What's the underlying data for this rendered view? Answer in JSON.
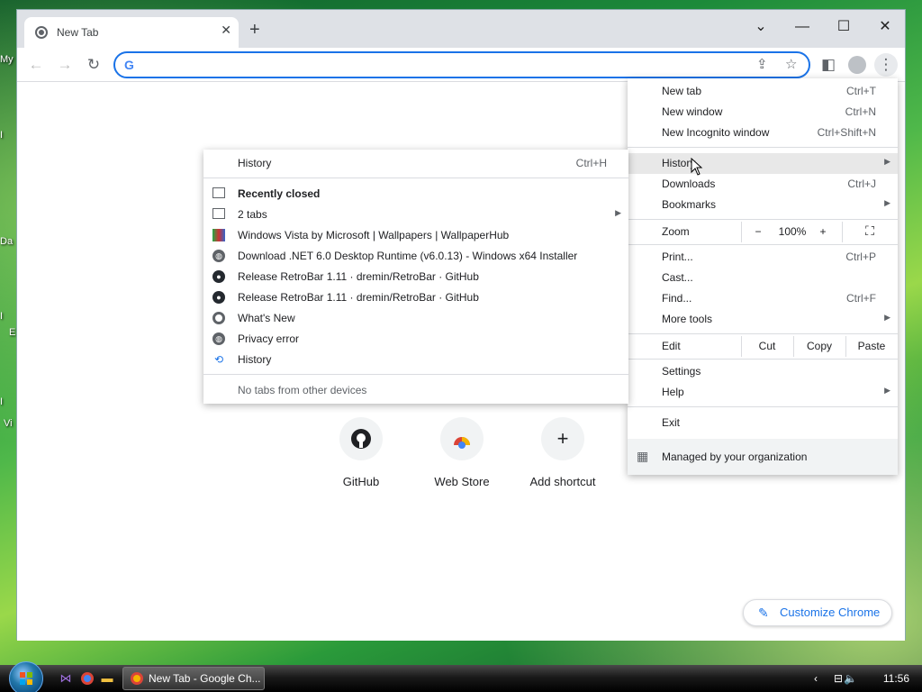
{
  "desktop": {
    "labels": [
      "My",
      "I",
      "Da",
      "I",
      "E",
      "I",
      "Vi"
    ]
  },
  "browser": {
    "tab_title": "New Tab",
    "tab_close": "✕",
    "new_tab_symbol": "+",
    "window_controls": {
      "dropdown": "⌄",
      "minimize": "—",
      "maximize": "☐",
      "close": "✕"
    },
    "toolbar": {
      "back": "←",
      "forward": "→",
      "reload": "↻",
      "omnibox_logo": "G",
      "omnibox_value": ""
    }
  },
  "chrome_menu": {
    "items_top": [
      {
        "label": "New tab",
        "shortcut": "Ctrl+T"
      },
      {
        "label": "New window",
        "shortcut": "Ctrl+N"
      },
      {
        "label": "New Incognito window",
        "shortcut": "Ctrl+Shift+N"
      }
    ],
    "history": {
      "label": "History",
      "highlighted": true
    },
    "downloads": {
      "label": "Downloads",
      "shortcut": "Ctrl+J"
    },
    "bookmarks": {
      "label": "Bookmarks"
    },
    "zoom": {
      "label": "Zoom",
      "minus": "−",
      "value": "100%",
      "plus": "+"
    },
    "items_tools": [
      {
        "label": "Print...",
        "shortcut": "Ctrl+P"
      },
      {
        "label": "Cast...",
        "shortcut": ""
      },
      {
        "label": "Find...",
        "shortcut": "Ctrl+F"
      }
    ],
    "more_tools": {
      "label": "More tools"
    },
    "edit": {
      "label": "Edit",
      "cut": "Cut",
      "copy": "Copy",
      "paste": "Paste"
    },
    "settings": {
      "label": "Settings"
    },
    "help": {
      "label": "Help"
    },
    "exit": {
      "label": "Exit"
    },
    "managed": {
      "label": "Managed by your organization"
    }
  },
  "history_submenu": {
    "header": {
      "label": "History",
      "shortcut": "Ctrl+H"
    },
    "recently_closed": "Recently closed",
    "entries": [
      {
        "label": "2 tabs",
        "icon": "tabs-icon"
      },
      {
        "label": "Windows Vista by Microsoft | Wallpapers | WallpaperHub",
        "icon": "wallpaperhub-favicon"
      },
      {
        "label": "Download .NET 6.0 Desktop Runtime (v6.0.13) - Windows x64 Installer",
        "icon": "globe-icon"
      },
      {
        "label": "Release RetroBar 1.11 · dremin/RetroBar · GitHub",
        "icon": "github-icon"
      },
      {
        "label": "Release RetroBar 1.11 · dremin/RetroBar · GitHub",
        "icon": "github-icon"
      },
      {
        "label": "What's New",
        "icon": "chrome-icon"
      },
      {
        "label": "Privacy error",
        "icon": "globe-icon"
      },
      {
        "label": "History",
        "icon": "history-icon"
      }
    ],
    "footer": "No tabs from other devices"
  },
  "shortcuts": [
    {
      "label": "GitHub",
      "icon": "github-icon"
    },
    {
      "label": "Web Store",
      "icon": "webstore-icon"
    },
    {
      "label": "Add shortcut",
      "icon": "plus-icon"
    }
  ],
  "customize": {
    "label": "Customize Chrome"
  },
  "taskbar": {
    "task_label": "New Tab - Google Ch...",
    "tray_arrow": "‹",
    "clock": "11:56 PM"
  }
}
